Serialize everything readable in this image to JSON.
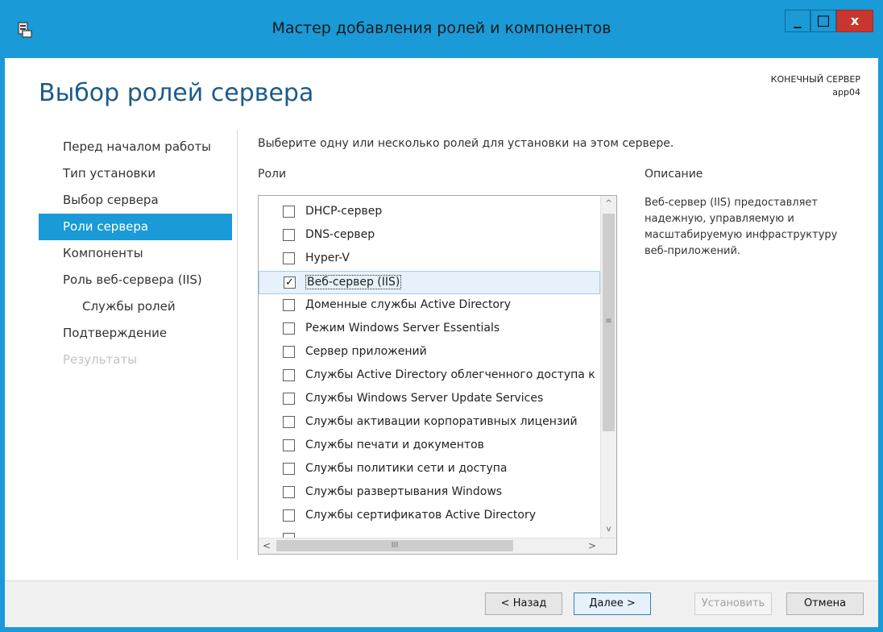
{
  "window": {
    "title": "Мастер добавления ролей и компонентов",
    "minimize": "_",
    "maximize": "□",
    "close": "x"
  },
  "header": {
    "page_title": "Выбор ролей сервера",
    "destination_label": "КОНЕЧНЫЙ СЕРВЕР",
    "destination_server": "app04"
  },
  "nav": {
    "items": [
      {
        "label": "Перед началом работы"
      },
      {
        "label": "Тип установки"
      },
      {
        "label": "Выбор сервера"
      },
      {
        "label": "Роли сервера"
      },
      {
        "label": "Компоненты"
      },
      {
        "label": "Роль веб-сервера (IIS)"
      },
      {
        "label": "Службы ролей"
      },
      {
        "label": "Подтверждение"
      },
      {
        "label": "Результаты"
      }
    ]
  },
  "main": {
    "instruction": "Выберите одну или несколько ролей для установки на этом сервере.",
    "roles_label": "Роли",
    "description_label": "Описание",
    "description_text": "Веб-сервер (IIS) предоставляет надежную, управляемую и масштабируемую инфраструктуру веб-приложений.",
    "roles": [
      {
        "label": "DHCP-сервер",
        "checked": false
      },
      {
        "label": "DNS-сервер",
        "checked": false
      },
      {
        "label": "Hyper-V",
        "checked": false
      },
      {
        "label": "Веб-сервер (IIS)",
        "checked": true
      },
      {
        "label": "Доменные службы Active Directory",
        "checked": false
      },
      {
        "label": "Режим Windows Server Essentials",
        "checked": false
      },
      {
        "label": "Сервер приложений",
        "checked": false
      },
      {
        "label": "Службы Active Directory облегченного доступа к",
        "checked": false
      },
      {
        "label": "Службы Windows Server Update Services",
        "checked": false
      },
      {
        "label": "Службы активации корпоративных лицензий",
        "checked": false
      },
      {
        "label": "Службы печати и документов",
        "checked": false
      },
      {
        "label": "Службы политики сети и доступа",
        "checked": false
      },
      {
        "label": "Службы развертывания Windows",
        "checked": false
      },
      {
        "label": "Службы сертификатов Active Directory",
        "checked": false
      },
      {
        "label": "",
        "checked": false
      }
    ],
    "scroll_up": "^",
    "scroll_down": "v",
    "scroll_left": "<",
    "scroll_right": ">",
    "grip": "≡",
    "hgrip": "III"
  },
  "footer": {
    "back": "< Назад",
    "next": "Далее >",
    "install": "Установить",
    "cancel": "Отмена"
  }
}
